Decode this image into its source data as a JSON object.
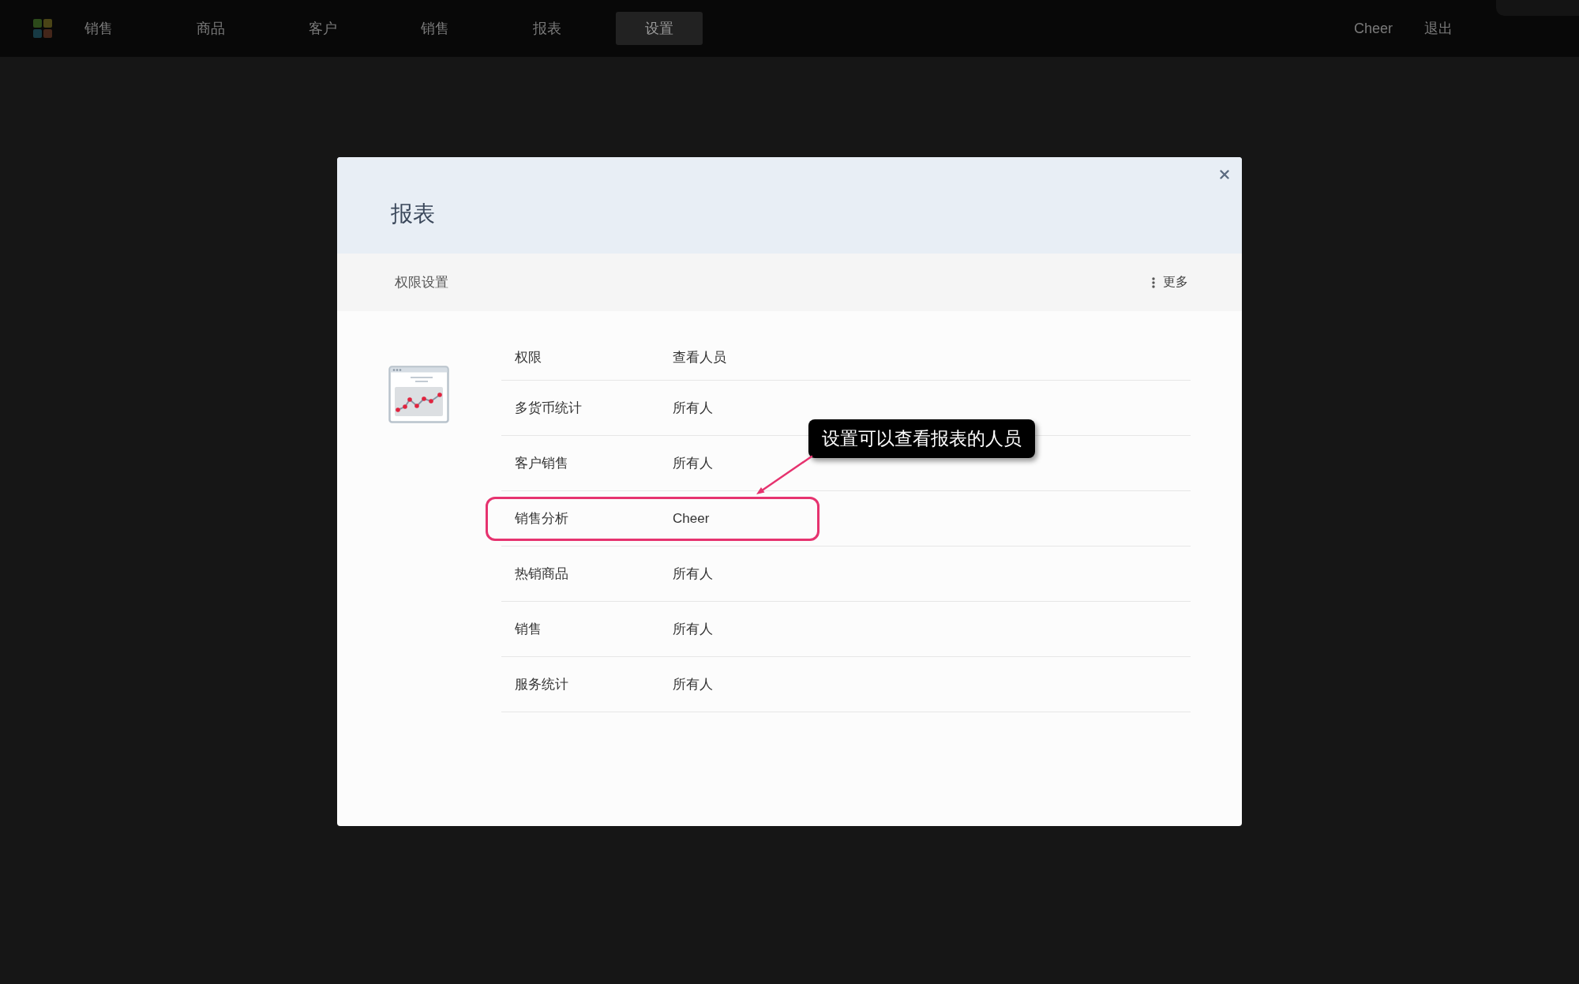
{
  "nav": {
    "items": [
      {
        "label": "销售",
        "selected": false
      },
      {
        "label": "商品",
        "selected": false
      },
      {
        "label": "客户",
        "selected": false
      },
      {
        "label": "销售",
        "selected": false
      },
      {
        "label": "报表",
        "selected": false
      },
      {
        "label": "设置",
        "selected": true
      }
    ],
    "user": "Cheer",
    "logout": "退出"
  },
  "dialog": {
    "title": "报表",
    "toolbar": {
      "title": "权限设置",
      "more": "更多"
    },
    "table": {
      "columns": [
        "权限",
        "查看人员"
      ],
      "rows": [
        {
          "cells": [
            "多货币统计",
            "所有人"
          ],
          "highlighted": false
        },
        {
          "cells": [
            "客户销售",
            "所有人"
          ],
          "highlighted": false
        },
        {
          "cells": [
            "销售分析",
            "Cheer"
          ],
          "highlighted": true
        },
        {
          "cells": [
            "热销商品",
            "所有人"
          ],
          "highlighted": false
        },
        {
          "cells": [
            "销售",
            "所有人"
          ],
          "highlighted": false
        },
        {
          "cells": [
            "服务统计",
            "所有人"
          ],
          "highlighted": false
        }
      ]
    },
    "callout": {
      "text": "设置可以查看报表的人员"
    }
  }
}
